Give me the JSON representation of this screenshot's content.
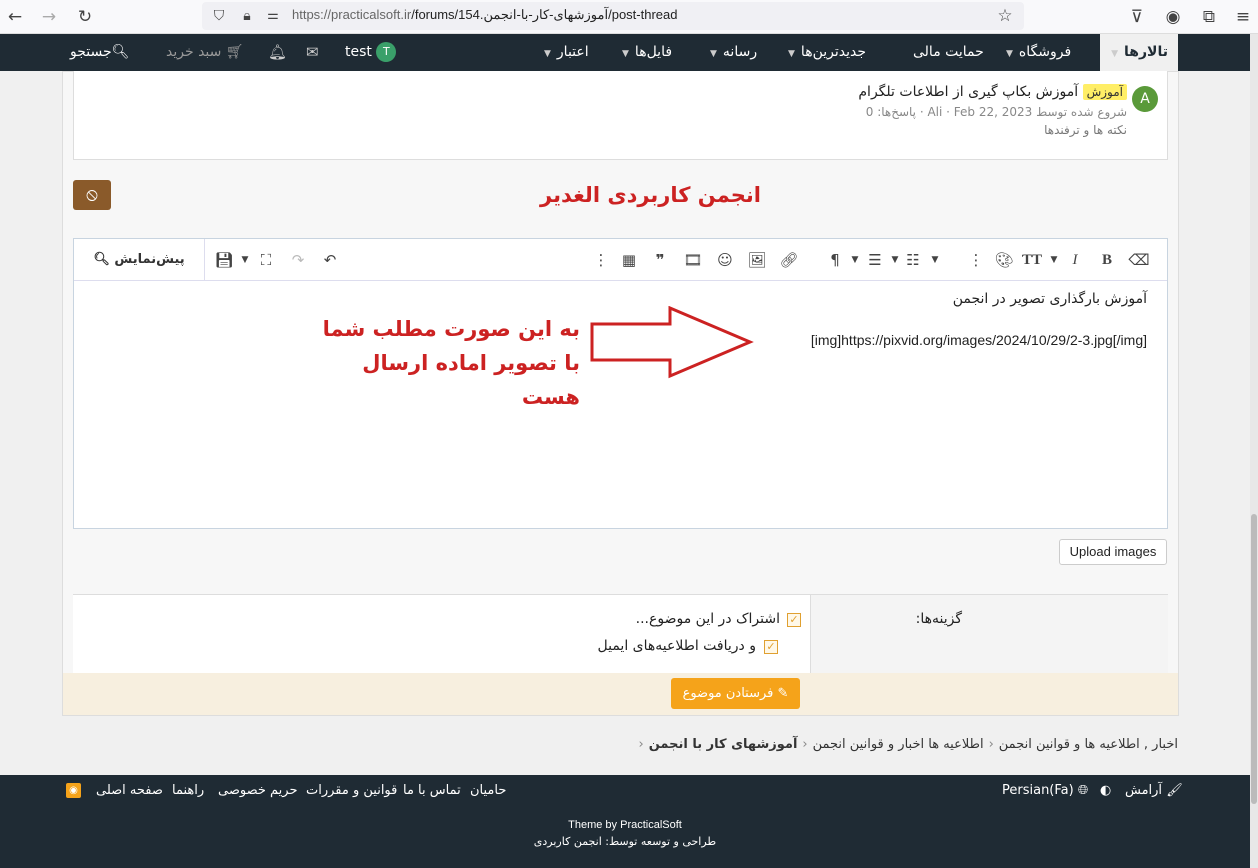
{
  "browser": {
    "url_prefix": "https://practicalsoft.ir",
    "url_rest": "/forums/154.آموزشهای-کار-با-انجمن/post-thread"
  },
  "nav": {
    "forums": "تالارها",
    "shop": "فروشگاه",
    "support": "حمایت مالی",
    "newest": "جدیدترین‌ها",
    "media": "رسانه",
    "files": "فایل‌ها",
    "credit": "اعتبار",
    "user": "test",
    "user_initial": "T",
    "cart": "سبد خرید",
    "search": "جستجو"
  },
  "thread": {
    "avatar": "A",
    "tag": "آموزش",
    "title": "آموزش بکاپ گیری از اطلاعات تلگرام",
    "meta": "شروع شده توسط Ali · Feb 22, 2023 · پاسخ‌ها: 0",
    "forum": "نکته ها و ترفندها"
  },
  "forum_title": "انجمن کاربردی الغدیر",
  "editor": {
    "preview": "پیش‌نمایش",
    "line1": "آموزش بارگذاری تصویر در انجمن",
    "line2": "[img]https://pixvid.org/images/2024/10/29/2-3.jpg[/img]"
  },
  "annotation": "به این صورت مطلب شما با تصویر اماده ارسال هست",
  "upload": "Upload images",
  "options": {
    "label": "گزینه‌ها:",
    "watch": "اشتراک در این موضوع...",
    "email": "و دریافت اطلاعیه‌های ایمیل"
  },
  "submit": "فرستادن موضوع",
  "breadcrumb": [
    "اخبار , اطلاعیه ها و قوانین انجمن",
    "اطلاعیه ها اخبار و قوانین انجمن",
    "آموزشهای کار با انجمن"
  ],
  "footer": {
    "style": "آرامش",
    "language": "Persian(Fa)",
    "sponsors": "حامیان",
    "contact": "تماس با ما",
    "rules": "قوانین و مقررات",
    "privacy": "حریم خصوصی",
    "help": "راهنما",
    "home": "صفحه اصلی",
    "theme": "Theme by PracticalSoft",
    "dev": "طراحی و توسعه توسط: انجمن کاربردی"
  }
}
